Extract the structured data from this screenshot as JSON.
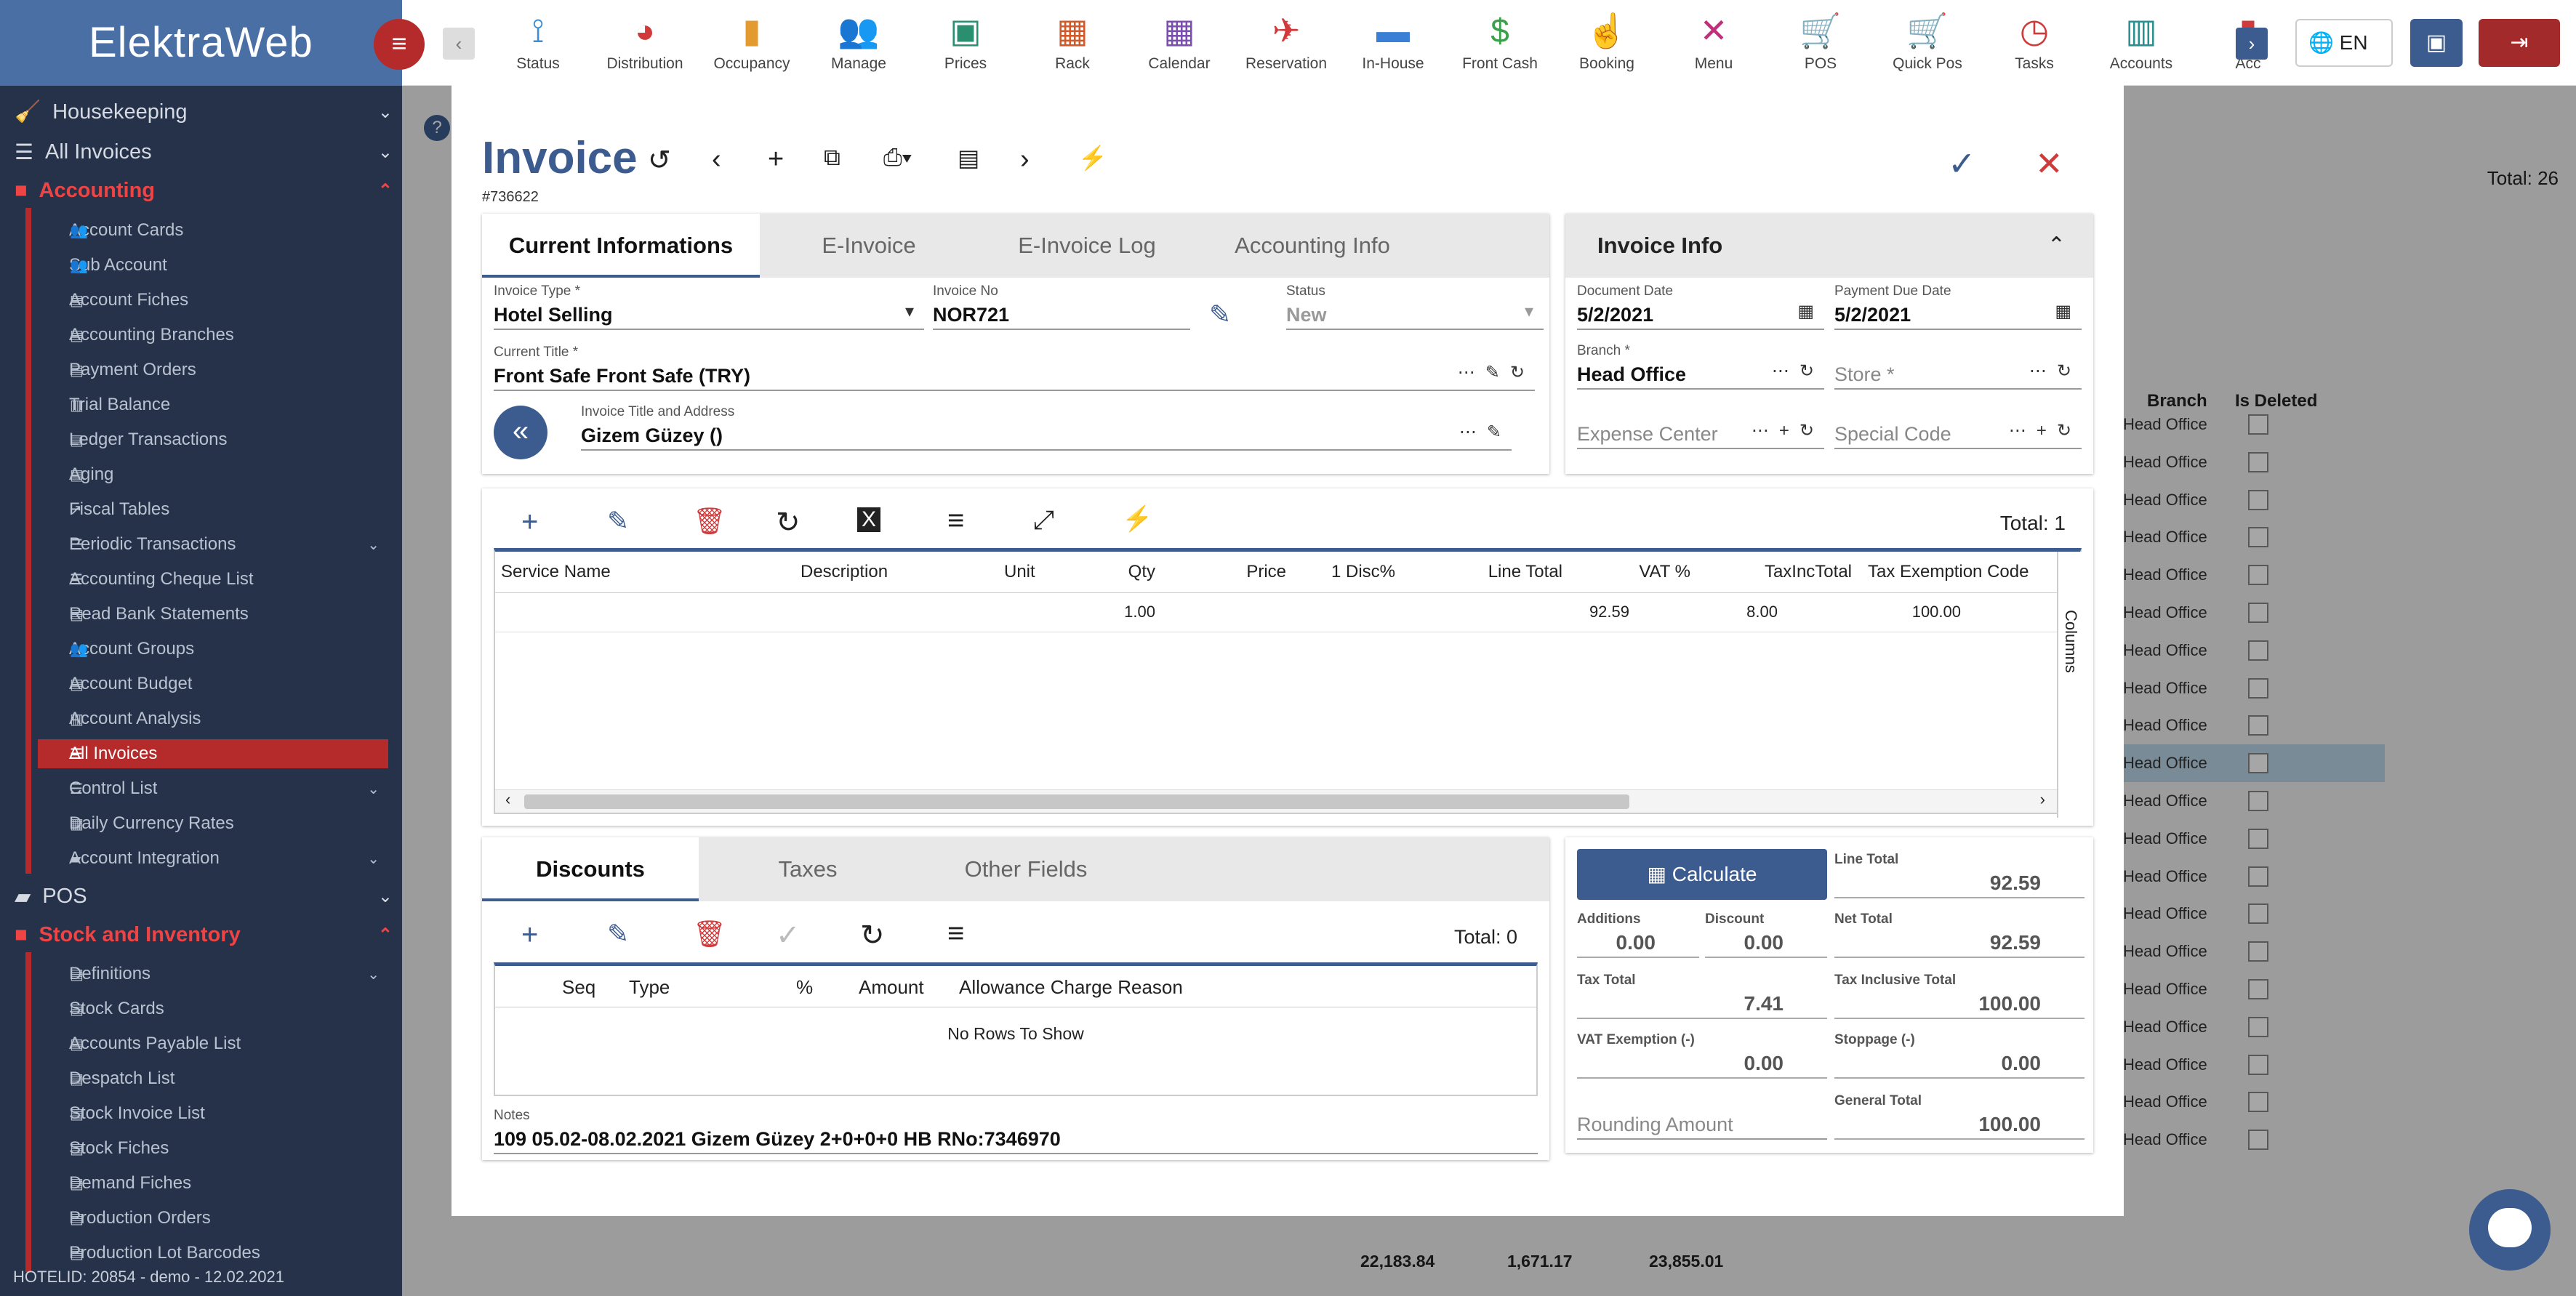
{
  "app": {
    "logo": "ElektraWeb",
    "footer": "HOTELID: 20854 - demo - 12.02.2021"
  },
  "sidebar": {
    "sections": [
      {
        "label": "Housekeeping",
        "icon": "broom-icon"
      },
      {
        "label": "All Invoices",
        "icon": "list-icon"
      },
      {
        "label": "Accounting",
        "icon": "accounting-icon"
      },
      {
        "label": "POS",
        "icon": "folder-icon"
      },
      {
        "label": "Stock and Inventory",
        "icon": "inventory-icon"
      }
    ],
    "accounting_items": [
      "Account Cards",
      "Sub Account",
      "Account Fiches",
      "Accounting Branches",
      "Payment Orders",
      "Trial Balance",
      "Ledger Transactions",
      "Aging",
      "Fiscal Tables",
      "Periodic Transactions",
      "Accounting Cheque List",
      "Read Bank Statements",
      "Account Groups",
      "Account Budget",
      "Account Analysis",
      "All Invoices",
      "Control List",
      "Daily Currency Rates",
      "Account Integration"
    ],
    "stock_items": [
      "Definitions",
      "Stock Cards",
      "Accounts Payable List",
      "Despatch List",
      "Stock Invoice List",
      "Stock Fiches",
      "Demand Fiches",
      "Production Orders",
      "Production Lot Barcodes"
    ]
  },
  "topbar": {
    "items": [
      {
        "label": "Status",
        "icon": "signal-icon",
        "color": "#3a8fd6"
      },
      {
        "label": "Distribution",
        "icon": "pie-icon",
        "color": "#d03a3a"
      },
      {
        "label": "Occupancy",
        "icon": "bars-icon",
        "color": "#e39a2e"
      },
      {
        "label": "Manage",
        "icon": "users-icon",
        "color": "#3a7fd6"
      },
      {
        "label": "Prices",
        "icon": "price-icon",
        "color": "#2a8f6f"
      },
      {
        "label": "Rack",
        "icon": "grid-icon",
        "color": "#d05a2a"
      },
      {
        "label": "Calendar",
        "icon": "calendar-icon",
        "color": "#7a4fb0"
      },
      {
        "label": "Reservation",
        "icon": "plane-icon",
        "color": "#d03a3a"
      },
      {
        "label": "In-House",
        "icon": "bed-icon",
        "color": "#3a7fd6"
      },
      {
        "label": "Front Cash",
        "icon": "cash-icon",
        "color": "#3aa04a"
      },
      {
        "label": "Booking",
        "icon": "hand-icon",
        "color": "#c0307a"
      },
      {
        "label": "Menu",
        "icon": "utensils-icon",
        "color": "#c0307a"
      },
      {
        "label": "POS",
        "icon": "cart-icon",
        "color": "#d03a3a"
      },
      {
        "label": "Quick Pos",
        "icon": "cart-icon",
        "color": "#7a4fb0"
      },
      {
        "label": "Tasks",
        "icon": "alarm-icon",
        "color": "#d03a3a"
      },
      {
        "label": "Accounts",
        "icon": "book-icon",
        "color": "#2a8f8f"
      },
      {
        "label": "Acc",
        "icon": "doc-icon",
        "color": "#d03a3a"
      }
    ],
    "lang": "EN"
  },
  "background": {
    "total": "Total: 26",
    "col_branch": "Branch",
    "col_deleted": "Is Deleted",
    "branch_value": "Head Office",
    "sum1": "22,183.84",
    "sum2": "1,671.17",
    "sum3": "23,855.01",
    "columns_label": "Columns"
  },
  "invoice": {
    "title": "Invoice",
    "number": "#736622",
    "tabs": [
      "Current Informations",
      "E-Invoice",
      "E-Invoice Log",
      "Accounting Info"
    ],
    "info_title": "Invoice Info",
    "fields": {
      "invoice_type_label": "Invoice Type *",
      "invoice_type": "Hotel Selling",
      "invoice_no_label": "Invoice No",
      "invoice_no": "NOR721",
      "status_label": "Status",
      "status": "New",
      "current_title_label": "Current Title *",
      "current_title": "Front Safe Front Safe (TRY)",
      "title_address_label": "Invoice Title and Address",
      "title_address": "Gizem Güzey ()",
      "document_date_label": "Document Date",
      "document_date": "5/2/2021",
      "payment_due_label": "Payment Due Date",
      "payment_due": "5/2/2021",
      "branch_label": "Branch *",
      "branch": "Head Office",
      "store": "Store *",
      "expense_center": "Expense Center",
      "special_code": "Special Code"
    },
    "lines": {
      "total": "Total: 1",
      "columns": [
        "Service Name",
        "Description",
        "Unit",
        "Qty",
        "Price",
        "1 Disc%",
        "Line Total",
        "VAT %",
        "TaxIncTotal",
        "Tax Exemption Code"
      ],
      "rows": [
        {
          "qty": "1.00",
          "line_total": "92.59",
          "vat": "8.00",
          "taxinc": "100.00"
        }
      ],
      "columns_label": "Columns"
    },
    "bottom_tabs": [
      "Discounts",
      "Taxes",
      "Other Fields"
    ],
    "discounts": {
      "total": "Total: 0",
      "columns": [
        "Seq",
        "Type",
        "%",
        "Amount",
        "Allowance Charge Reason"
      ],
      "empty": "No Rows To Show"
    },
    "notes_label": "Notes",
    "notes": "109 05.02-08.02.2021 Gizem Güzey 2+0+0+0 HB RNo:7346970",
    "totals": {
      "calculate": "Calculate",
      "line_total_label": "Line Total",
      "line_total": "92.59",
      "additions_label": "Additions",
      "additions": "0.00",
      "discount_label": "Discount",
      "discount": "0.00",
      "net_total_label": "Net Total",
      "net_total": "92.59",
      "tax_total_label": "Tax Total",
      "tax_total": "7.41",
      "tax_incl_label": "Tax Inclusive Total",
      "tax_incl": "100.00",
      "vat_exempt_label": "VAT Exemption (-)",
      "vat_exempt": "0.00",
      "stoppage_label": "Stoppage (-)",
      "stoppage": "0.00",
      "rounding_label": "Rounding Amount",
      "general_total_label": "General Total",
      "general_total": "100.00"
    }
  }
}
